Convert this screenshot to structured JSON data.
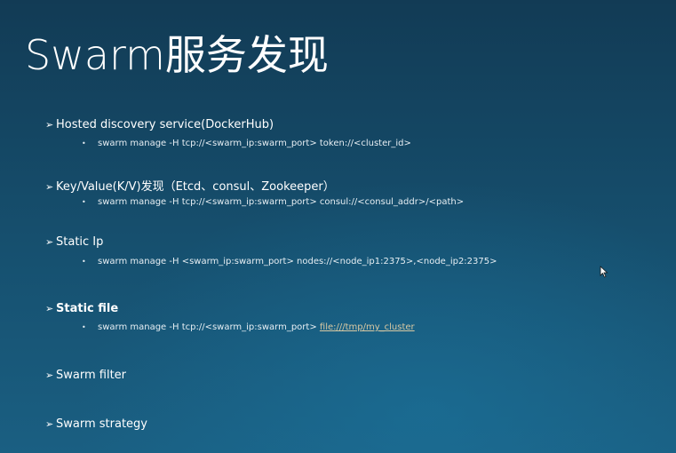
{
  "slide": {
    "title": "Swarm服务发现",
    "items": [
      {
        "label": "Hosted discovery service(DockerHub)",
        "sub": "swarm manage -H tcp://<swarm_ip:swarm_port> token://<cluster_id>"
      },
      {
        "label": "Key/Value(K/V)发现（Etcd、consul、Zookeeper）",
        "sub": "swarm manage -H tcp://<swarm_ip:swarm_port> consul://<consul_addr>/<path>"
      },
      {
        "label": "Static Ip",
        "sub": "swarm manage -H <swarm_ip:swarm_port> nodes://<node_ip1:2375>,<node_ip2:2375>"
      },
      {
        "label": "Static file",
        "sub_prefix": "swarm manage -H tcp://<swarm_ip:swarm_port> ",
        "sub_link": "file:///tmp/my_cluster"
      },
      {
        "label": "Swarm filter"
      },
      {
        "label": "Swarm strategy"
      }
    ],
    "arrow_glyph": "➢",
    "bullet_glyph": "•"
  }
}
